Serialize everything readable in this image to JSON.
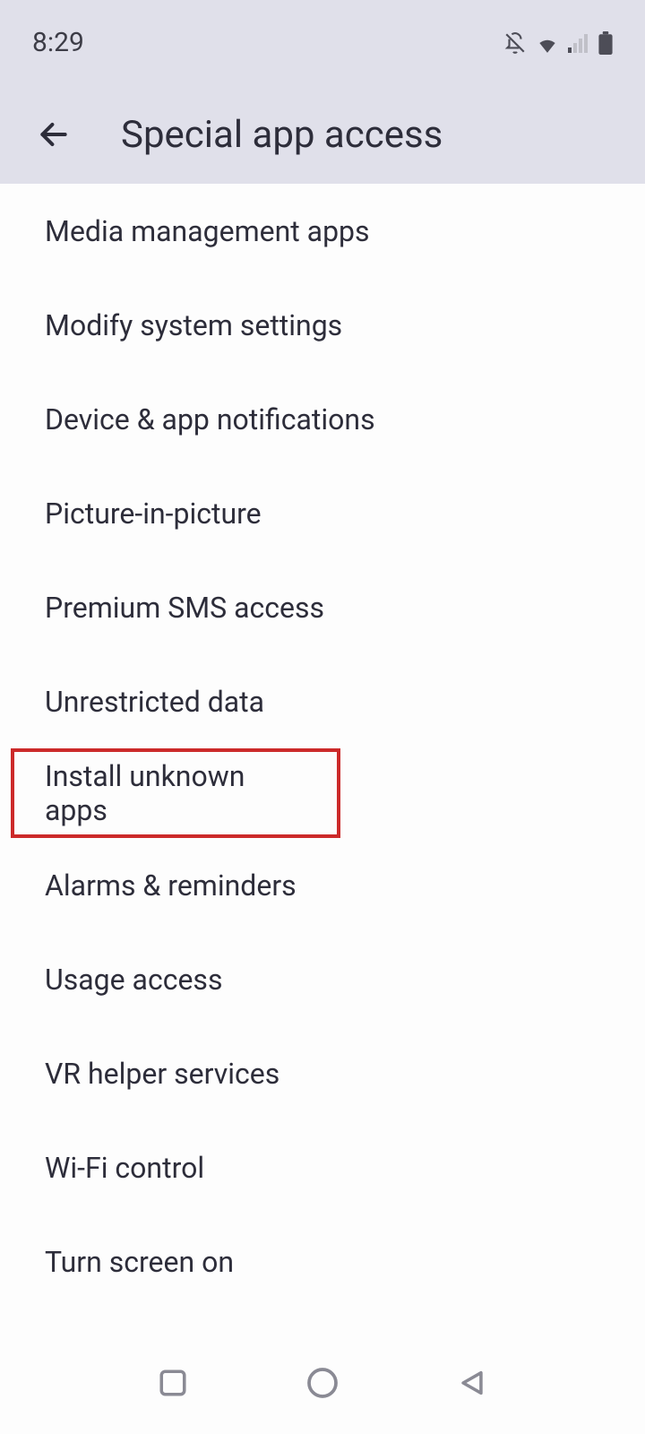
{
  "status_bar": {
    "time": "8:29"
  },
  "header": {
    "title": "Special app access"
  },
  "items": [
    {
      "label": "Media management apps",
      "highlighted": false
    },
    {
      "label": "Modify system settings",
      "highlighted": false
    },
    {
      "label": "Device & app notifications",
      "highlighted": false
    },
    {
      "label": "Picture-in-picture",
      "highlighted": false
    },
    {
      "label": "Premium SMS access",
      "highlighted": false
    },
    {
      "label": "Unrestricted data",
      "highlighted": false
    },
    {
      "label": "Install unknown apps",
      "highlighted": true
    },
    {
      "label": "Alarms & reminders",
      "highlighted": false
    },
    {
      "label": "Usage access",
      "highlighted": false
    },
    {
      "label": "VR helper services",
      "highlighted": false
    },
    {
      "label": "Wi-Fi control",
      "highlighted": false
    },
    {
      "label": "Turn screen on",
      "highlighted": false
    }
  ]
}
